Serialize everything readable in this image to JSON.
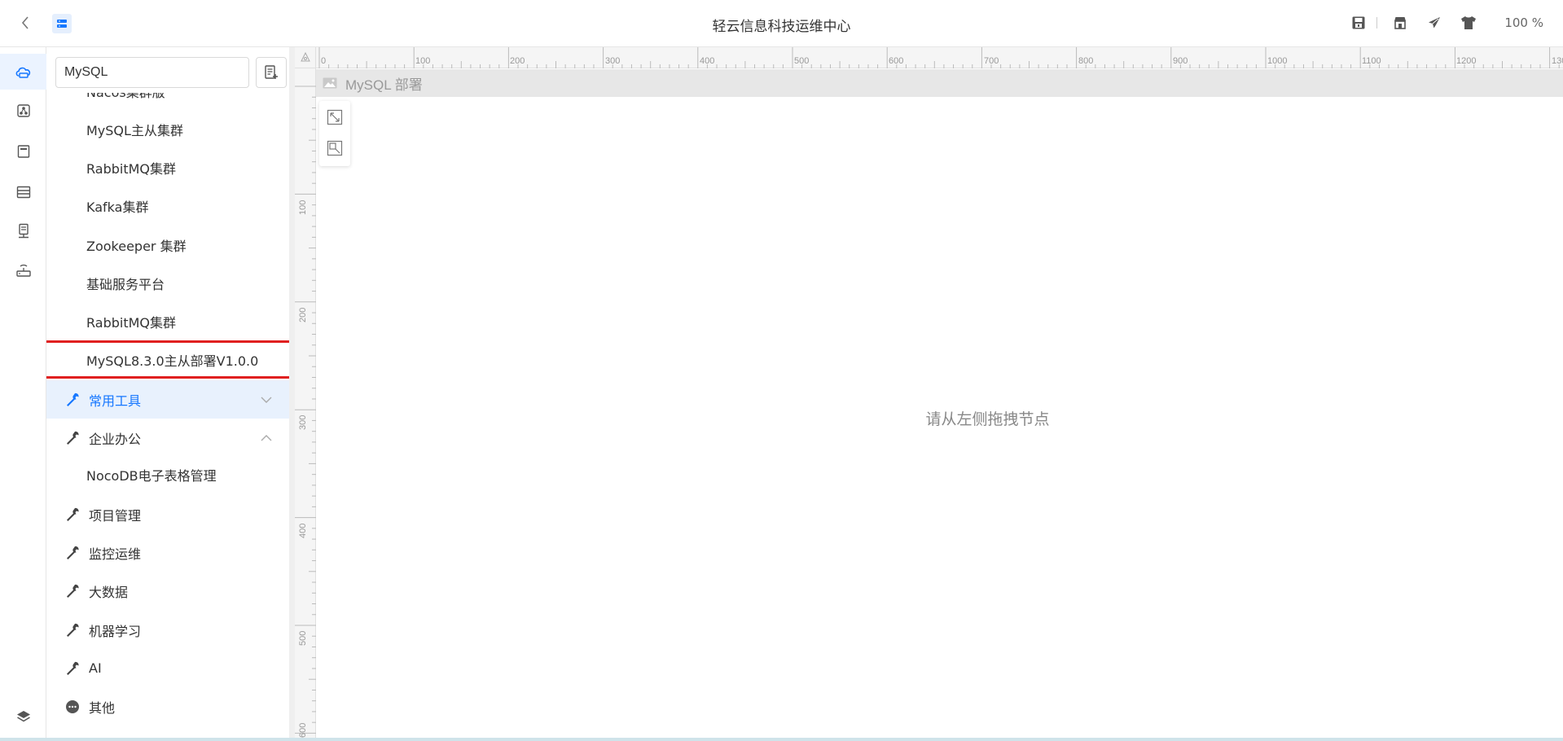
{
  "header": {
    "title": "轻云信息科技运维中心",
    "zoom": "100 %"
  },
  "sidebar": {
    "search_value": "MySQL",
    "rail_items": [
      "cloud-icon",
      "topology-icon",
      "page-icon",
      "storage-icon",
      "server-icon",
      "router-icon",
      "layers-icon"
    ]
  },
  "panel": {
    "partial_item": "Nacos集群版",
    "items": [
      "MySQL主从集群",
      "RabbitMQ集群",
      "Kafka集群",
      "Zookeeper 集群",
      "基础服务平台",
      "RabbitMQ集群",
      "MySQL8.3.0主从部署V1.0.0"
    ],
    "categories": [
      {
        "label": "常用工具",
        "expanded": false,
        "highlighted": true
      },
      {
        "label": "企业办公",
        "expanded": true,
        "highlighted": false
      }
    ],
    "office_items": [
      "NocoDB电子表格管理"
    ],
    "more_categories": [
      "项目管理",
      "监控运维",
      "大数据",
      "机器学习",
      "AI"
    ],
    "other_label": "其他"
  },
  "canvas": {
    "page_title": "MySQL 部署",
    "hint": "请从左侧拖拽节点",
    "ruler_h": [
      "0",
      "100",
      "200",
      "300",
      "400",
      "500",
      "600",
      "700",
      "800",
      "900",
      "1000",
      "1100",
      "1200",
      "130"
    ],
    "ruler_v": [
      "100",
      "200",
      "300",
      "400",
      "500",
      "600"
    ]
  },
  "colors": {
    "accent": "#1677ff",
    "highlight_bg": "#e8f1fd",
    "annotation_red": "#e02020"
  }
}
